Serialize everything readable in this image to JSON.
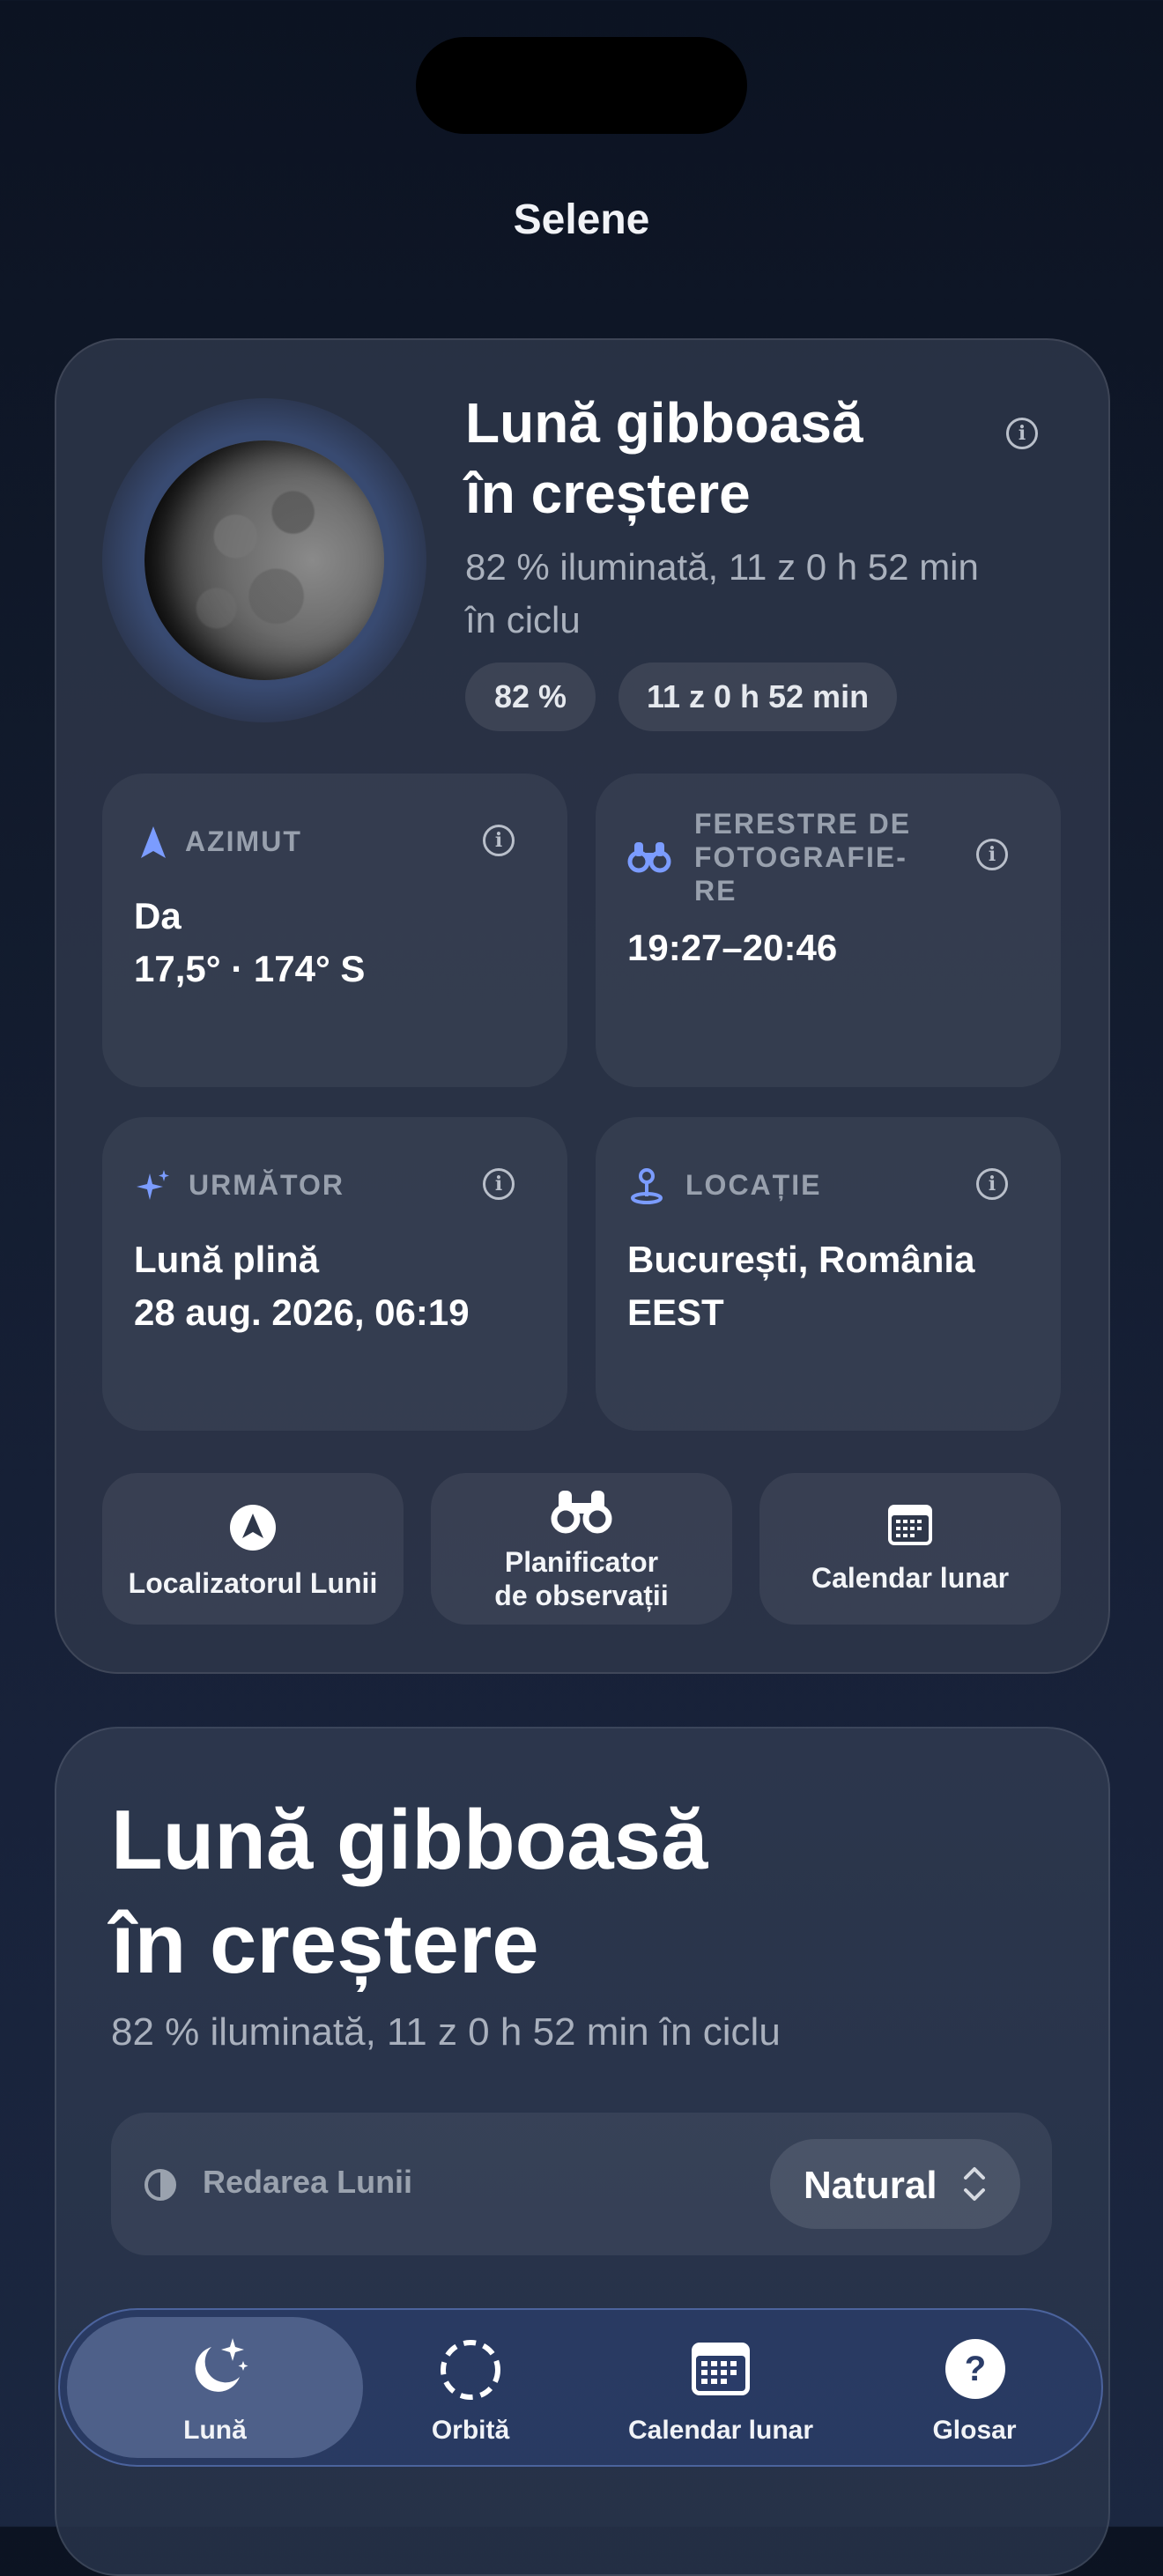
{
  "app": {
    "title": "Selene"
  },
  "phase": {
    "name_line1": "Lună gibboasă",
    "name_line2": "în creștere",
    "subtitle_line1": "82 % iluminată, 11 z 0 h 52 min",
    "subtitle_line2": "în ciclu",
    "illumination_pill": "82 %",
    "age_pill": "11 z 0 h 52 min",
    "illumination_fraction": 0.82
  },
  "tiles": {
    "azimuth": {
      "label": "AZIMUT",
      "line1": "Da",
      "line2": "17,5° · 174° S",
      "icon": "location-arrow-icon"
    },
    "photo": {
      "label_line1": "FERESTRE DE",
      "label_line2": "FOTOGRAFIE-",
      "label_line3": "RE",
      "value": "19:27–20:46",
      "icon": "binoculars-icon"
    },
    "next": {
      "label": "URMĂTOR",
      "line1": "Lună plină",
      "line2": "28 aug. 2026, 06:19",
      "icon": "sparkles-icon"
    },
    "location": {
      "label": "LOCAȚIE",
      "line1": "București, România",
      "line2": "EEST",
      "icon": "map-pin-icon"
    }
  },
  "actions": {
    "locator": {
      "label": "Localizatorul Lunii",
      "icon": "compass-arrow-icon"
    },
    "planner": {
      "label_line1": "Planificator",
      "label_line2": "de observații",
      "icon": "binoculars-icon"
    },
    "calendar": {
      "label": "Calendar lunar",
      "icon": "calendar-icon"
    }
  },
  "detail": {
    "title_line1": "Lună gibboasă",
    "title_line2": "în creștere",
    "subtitle": "82 % iluminată, 11 z 0 h 52 min în ciclu",
    "render_label": "Redarea Lunii",
    "render_value": "Natural"
  },
  "tabbar": {
    "tabs": [
      {
        "label": "Lună",
        "icon": "moon-stars-icon",
        "active": true
      },
      {
        "label": "Orbită",
        "icon": "orbit-icon",
        "active": false
      },
      {
        "label": "Calendar lunar",
        "icon": "calendar-icon",
        "active": false
      },
      {
        "label": "Glosar",
        "icon": "question-icon",
        "active": false
      }
    ]
  },
  "colors": {
    "accent": "#6f8ff0",
    "background": "#121b2d",
    "card": "#2e374a"
  }
}
